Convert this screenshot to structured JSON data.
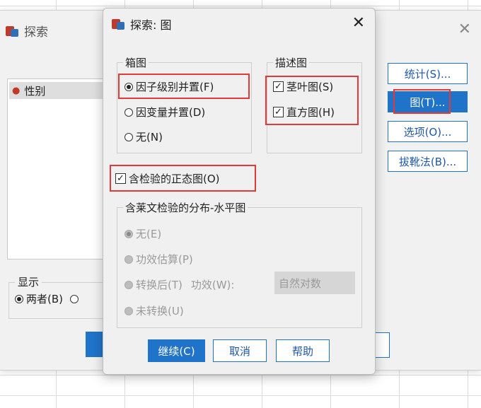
{
  "back_window": {
    "title": "探索",
    "variable_item": "性别",
    "display_legend": "显示",
    "display_option": "两者(B)"
  },
  "side_buttons": {
    "statistics": "统计(S)...",
    "plots": "图(T)...",
    "options": "选项(O)...",
    "bootstrap": "拔靴法(B)..."
  },
  "dialog": {
    "title": "探索: 图",
    "boxplot": {
      "legend": "箱图",
      "factor_levels_together": "因子级别并置(F)",
      "dependents_together": "因变量并置(D)",
      "none": "无(N)"
    },
    "descriptive": {
      "legend": "描述图",
      "stem_leaf": "茎叶图(S)",
      "histogram": "直方图(H)"
    },
    "normality": "含检验的正态图(O)",
    "levene": {
      "legend": "含莱文检验的分布-水平图",
      "none": "无(E)",
      "power_estimation": "功效估算(P)",
      "transformed": "转换后(T)",
      "power_label": "功效(W):",
      "power_value": "自然对数",
      "untransformed": "未转换(U)"
    },
    "buttons": {
      "continue": "继续(C)",
      "cancel": "取消",
      "help": "帮助"
    }
  }
}
